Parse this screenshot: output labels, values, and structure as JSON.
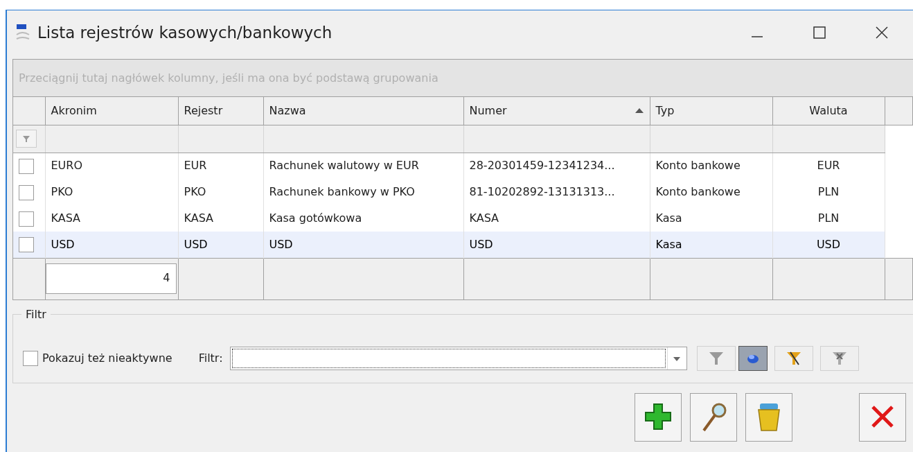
{
  "window": {
    "title": "Lista rejestrów kasowych/bankowych"
  },
  "grid": {
    "group_hint": "Przeciągnij tutaj nagłówek kolumny, jeśli ma ona być podstawą grupowania",
    "columns": [
      {
        "label": "Akronim",
        "sorted": false
      },
      {
        "label": "Rejestr",
        "sorted": false
      },
      {
        "label": "Nazwa",
        "sorted": false
      },
      {
        "label": "Numer",
        "sorted": true
      },
      {
        "label": "Typ",
        "sorted": false
      },
      {
        "label": "Waluta",
        "sorted": false
      }
    ],
    "rows": [
      {
        "checked": false,
        "selected": false,
        "cells": [
          "EURO",
          "EUR",
          "Rachunek walutowy w EUR",
          "28-20301459-12341234...",
          "Konto bankowe",
          "EUR"
        ]
      },
      {
        "checked": false,
        "selected": false,
        "cells": [
          "PKO",
          "PKO",
          "Rachunek bankowy w PKO",
          "81-10202892-13131313...",
          "Konto bankowe",
          "PLN"
        ]
      },
      {
        "checked": false,
        "selected": false,
        "cells": [
          "KASA",
          "KASA",
          "Kasa gotówkowa",
          "KASA",
          "Kasa",
          "PLN"
        ]
      },
      {
        "checked": false,
        "selected": true,
        "cells": [
          "USD",
          "USD",
          "USD",
          "USD",
          "Kasa",
          "USD"
        ]
      }
    ],
    "footer_count": "4"
  },
  "filter": {
    "legend": "Filtr",
    "show_inactive": {
      "label": "Pokazuj też nieaktywne",
      "checked": false
    },
    "field_label": "Filtr:",
    "tools": [
      {
        "kind": "funnel",
        "pressed": false
      },
      {
        "kind": "blob",
        "pressed": true
      },
      {
        "kind": "wand",
        "pressed": false
      },
      {
        "kind": "clear",
        "pressed": false
      }
    ]
  },
  "actions": [
    {
      "kind": "add"
    },
    {
      "kind": "view"
    },
    {
      "kind": "delete"
    },
    {
      "kind": "close"
    }
  ]
}
